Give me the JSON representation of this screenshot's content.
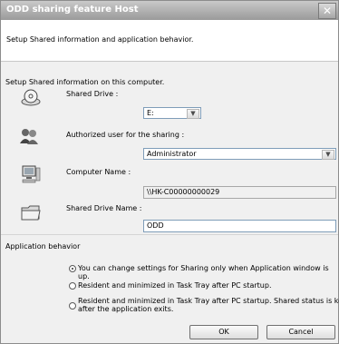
{
  "window": {
    "title": "ODD sharing feature Host",
    "close_glyph": "✕"
  },
  "header": {
    "text": "Setup Shared information and application behavior."
  },
  "section_shared": {
    "label": "Setup Shared information on this computer.",
    "shared_drive": {
      "label": "Shared Drive :",
      "value": "E:",
      "icon": "drive-icon"
    },
    "authorized_user": {
      "label": "Authorized user for the sharing :",
      "value": "Administrator",
      "icon": "users-icon"
    },
    "computer_name": {
      "label": "Computer Name :",
      "value": "\\\\HK-C00000000029",
      "icon": "computer-icon"
    },
    "shared_drive_name": {
      "label": "Shared Drive Name :",
      "value": "ODD",
      "icon": "folder-icon"
    }
  },
  "section_behavior": {
    "label": "Application behavior",
    "options": [
      {
        "label": "You can change settings for Sharing only when Application window is up.",
        "selected": true
      },
      {
        "label": "Resident and minimized in Task Tray after PC startup.",
        "selected": false
      },
      {
        "label_line1": "Resident and minimized in Task Tray after PC startup. Shared status is kept",
        "label_line2": "after the application exits.",
        "selected": false
      }
    ]
  },
  "buttons": {
    "ok": "OK",
    "cancel": "Cancel"
  }
}
